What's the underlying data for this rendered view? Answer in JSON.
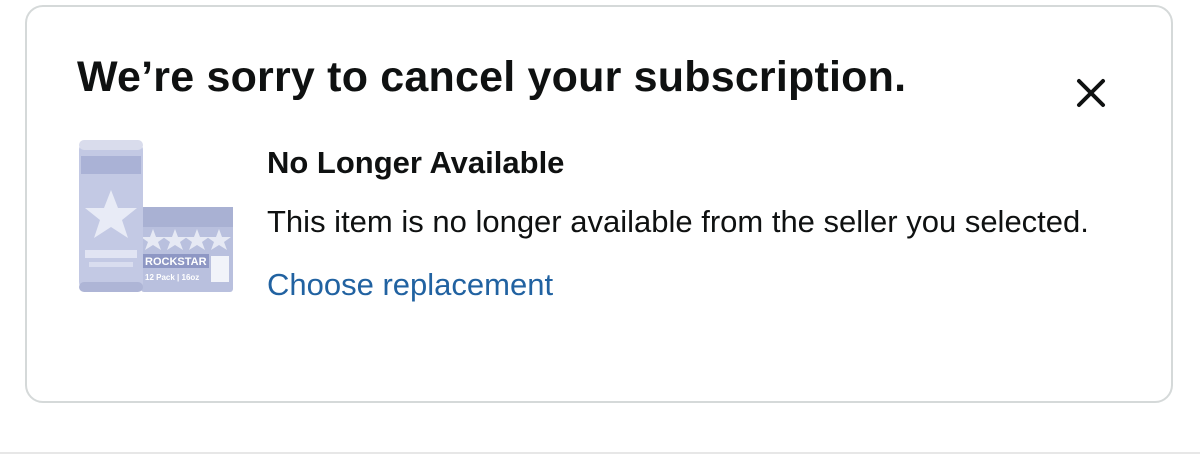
{
  "modal": {
    "title": "We’re sorry to cancel your subscription.",
    "close_icon": "close-icon"
  },
  "item": {
    "image_icon": "product-image",
    "image_brand_text": "ROCKSTAR",
    "image_pack_text": "12 Pack | 16oz",
    "status_title": "No Longer Available",
    "status_message": "This item is no longer available from the seller you selected.",
    "action_label": "Choose replacement"
  },
  "colors": {
    "link": "#2162a1",
    "text": "#0f1111",
    "border": "#d5d9d9",
    "product_tint": "#b9c0de"
  }
}
